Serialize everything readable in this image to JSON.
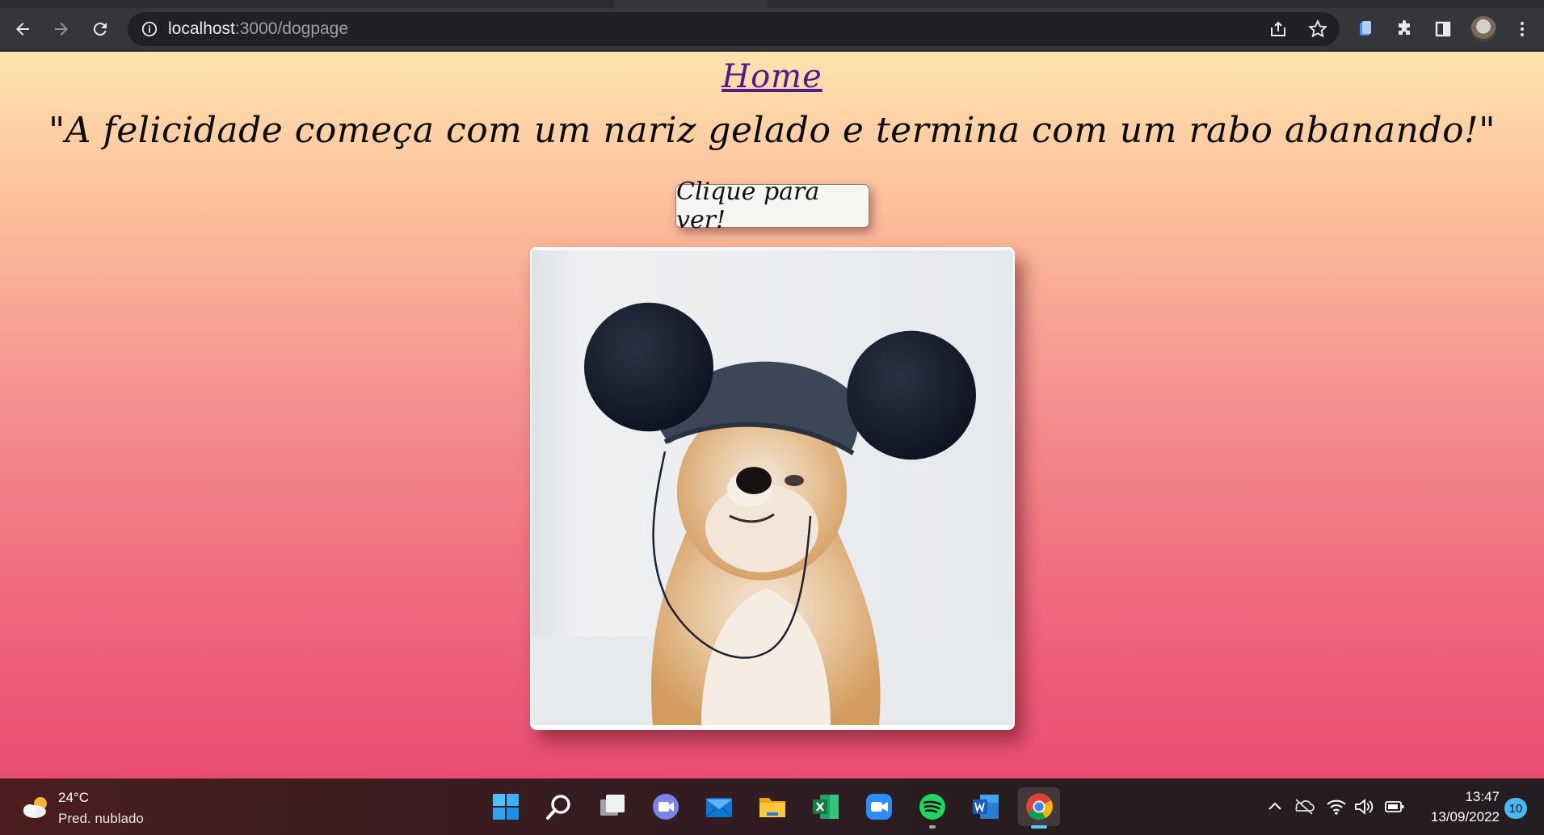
{
  "browser": {
    "url_host": "localhost",
    "url_path": ":3000/dogpage",
    "icons": [
      "back-icon",
      "forward-icon",
      "reload-icon",
      "info-icon",
      "share-icon",
      "star-icon",
      "docs-extension-icon",
      "puzzle-extension-icon",
      "side-panel-icon",
      "profile-avatar",
      "menu-kebab-icon"
    ]
  },
  "page": {
    "home_link": "Home",
    "quote": "\"A felicidade começa com um nariz gelado e termina com um rabo abanando!\"",
    "button_label": "Clique para ver!",
    "image_subject": "shiba inu wearing mouse-ear hat"
  },
  "taskbar": {
    "weather_temp": "24°C",
    "weather_desc": "Pred. nublado",
    "apps": [
      "start",
      "search",
      "task-view",
      "teams-chat",
      "mail",
      "file-explorer",
      "excel",
      "zoom",
      "spotify",
      "word",
      "chrome"
    ],
    "time": "13:47",
    "date": "13/09/2022",
    "notification_count": "10"
  },
  "colors": {
    "page_gradient_top": "#ffe3ad",
    "page_gradient_bottom": "#ea4c70",
    "link": "#551a8b",
    "chrome_dark": "#35363a"
  }
}
